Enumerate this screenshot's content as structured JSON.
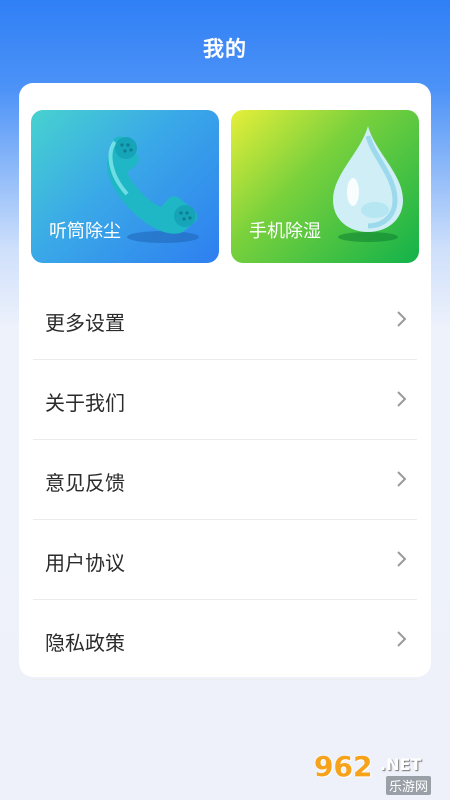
{
  "header": {
    "title": "我的"
  },
  "tiles": [
    {
      "label": "听筒除尘",
      "icon": "phone-handset-icon"
    },
    {
      "label": "手机除湿",
      "icon": "water-drop-icon"
    }
  ],
  "menu": {
    "items": [
      {
        "label": "更多设置"
      },
      {
        "label": "关于我们"
      },
      {
        "label": "意见反馈"
      },
      {
        "label": "用户协议"
      },
      {
        "label": "隐私政策"
      }
    ]
  },
  "watermark": {
    "main": "962",
    "suffix": ".NET",
    "site": "乐游网"
  },
  "colors": {
    "header_blue": "#2f7ff6",
    "tile_blue": "#2e7ff0",
    "tile_green": "#12b24a"
  }
}
